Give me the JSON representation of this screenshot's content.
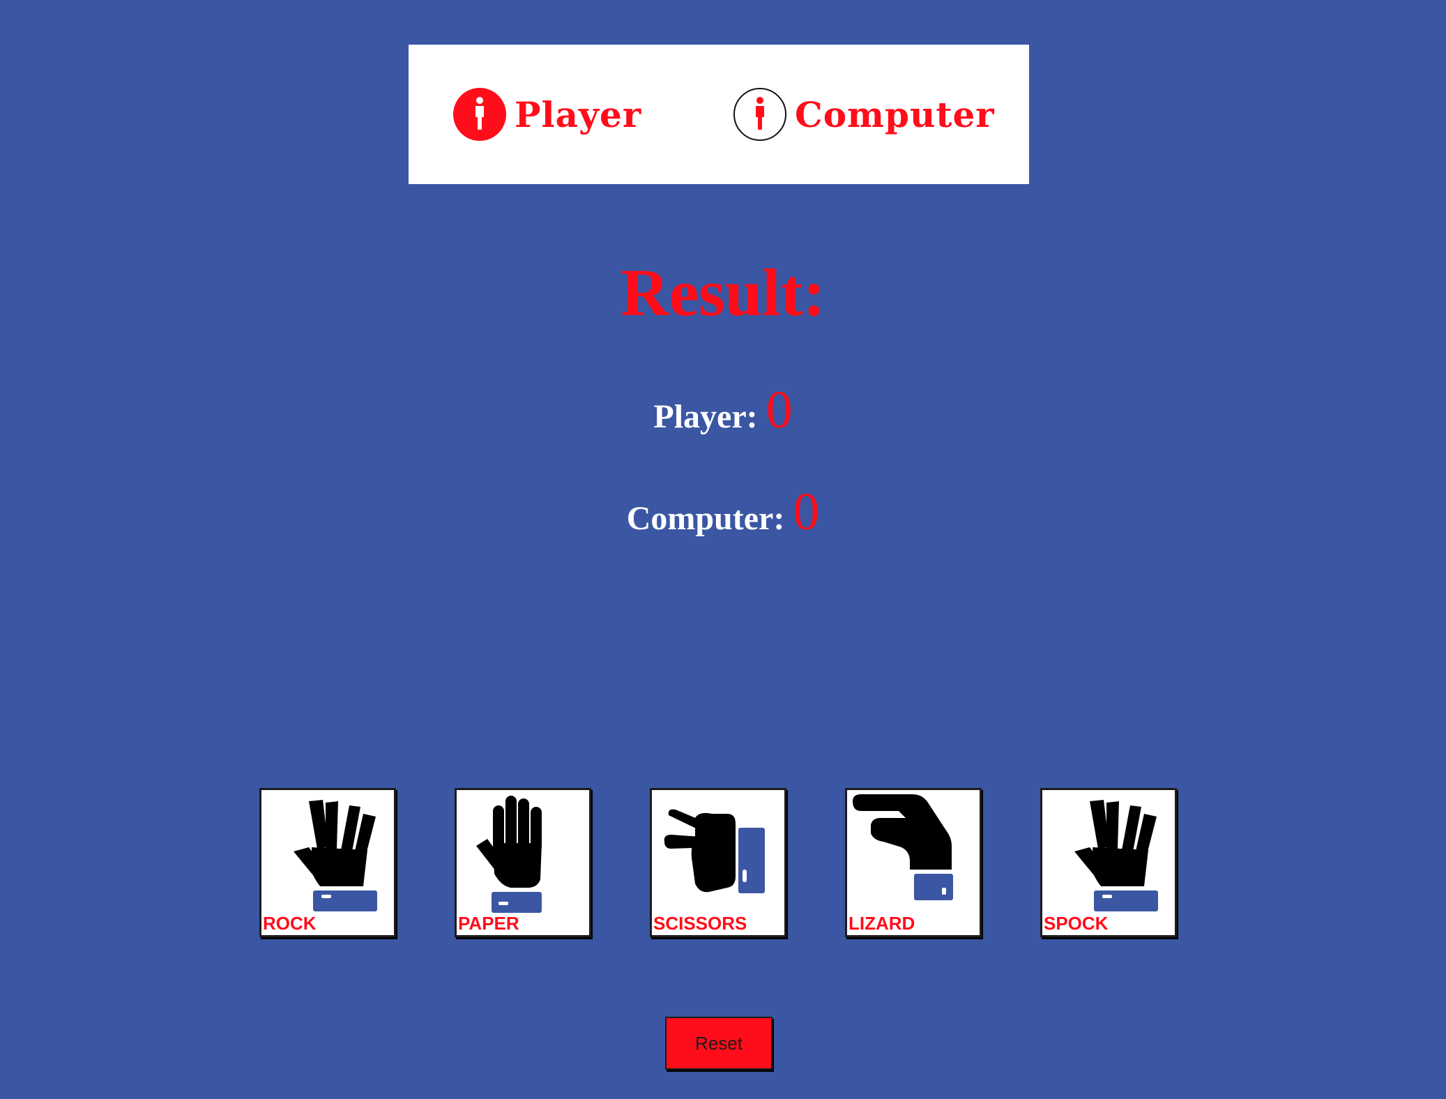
{
  "header": {
    "player_label": "Player",
    "computer_label": "Computer",
    "player_icon": "person-icon",
    "computer_icon": "person-icon"
  },
  "result": {
    "title": "Result:"
  },
  "scores": {
    "player_label": "Player:",
    "player_value": "0",
    "computer_label": "Computer:",
    "computer_value": "0"
  },
  "choices": [
    {
      "label": "ROCK",
      "icon": "spock-hand-icon"
    },
    {
      "label": "PAPER",
      "icon": "open-hand-icon"
    },
    {
      "label": "SCISSORS",
      "icon": "scissors-hand-icon"
    },
    {
      "label": "LIZARD",
      "icon": "lizard-hand-icon"
    },
    {
      "label": "SPOCK",
      "icon": "spock-hand-icon"
    }
  ],
  "reset": {
    "label": "Reset"
  },
  "colors": {
    "background": "#3b57a3",
    "accent": "#ff0d1a",
    "panel": "#ffffff"
  }
}
